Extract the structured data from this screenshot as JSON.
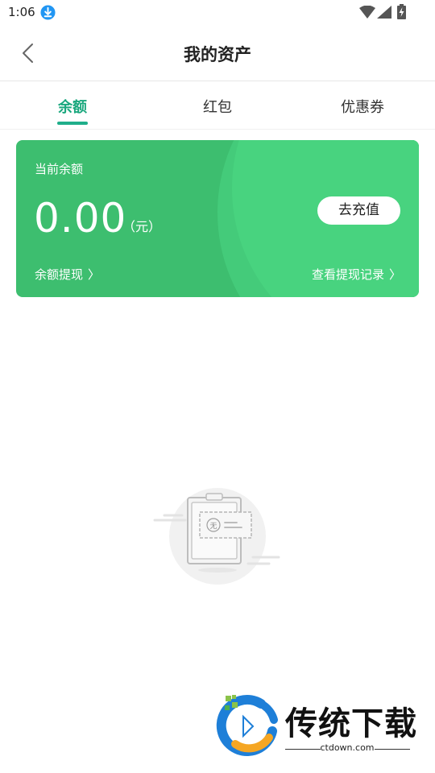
{
  "status_bar": {
    "time": "1:06"
  },
  "header": {
    "title": "我的资产"
  },
  "tabs": [
    {
      "label": "余额",
      "active": true
    },
    {
      "label": "红包",
      "active": false
    },
    {
      "label": "优惠券",
      "active": false
    }
  ],
  "balance_card": {
    "label": "当前余额",
    "amount": "0.00",
    "unit": "（元）",
    "recharge_label": "去充值",
    "withdraw_label": "余额提现",
    "records_label": "查看提现记录",
    "chevron": "〉"
  },
  "empty_state": {
    "icon_text": "无"
  },
  "watermark": {
    "title": "传统下载",
    "domain": "ctdown.com"
  },
  "colors": {
    "accent": "#1fae8a",
    "card_green": "#3dbe6f",
    "card_green_light": "#48d37f"
  }
}
